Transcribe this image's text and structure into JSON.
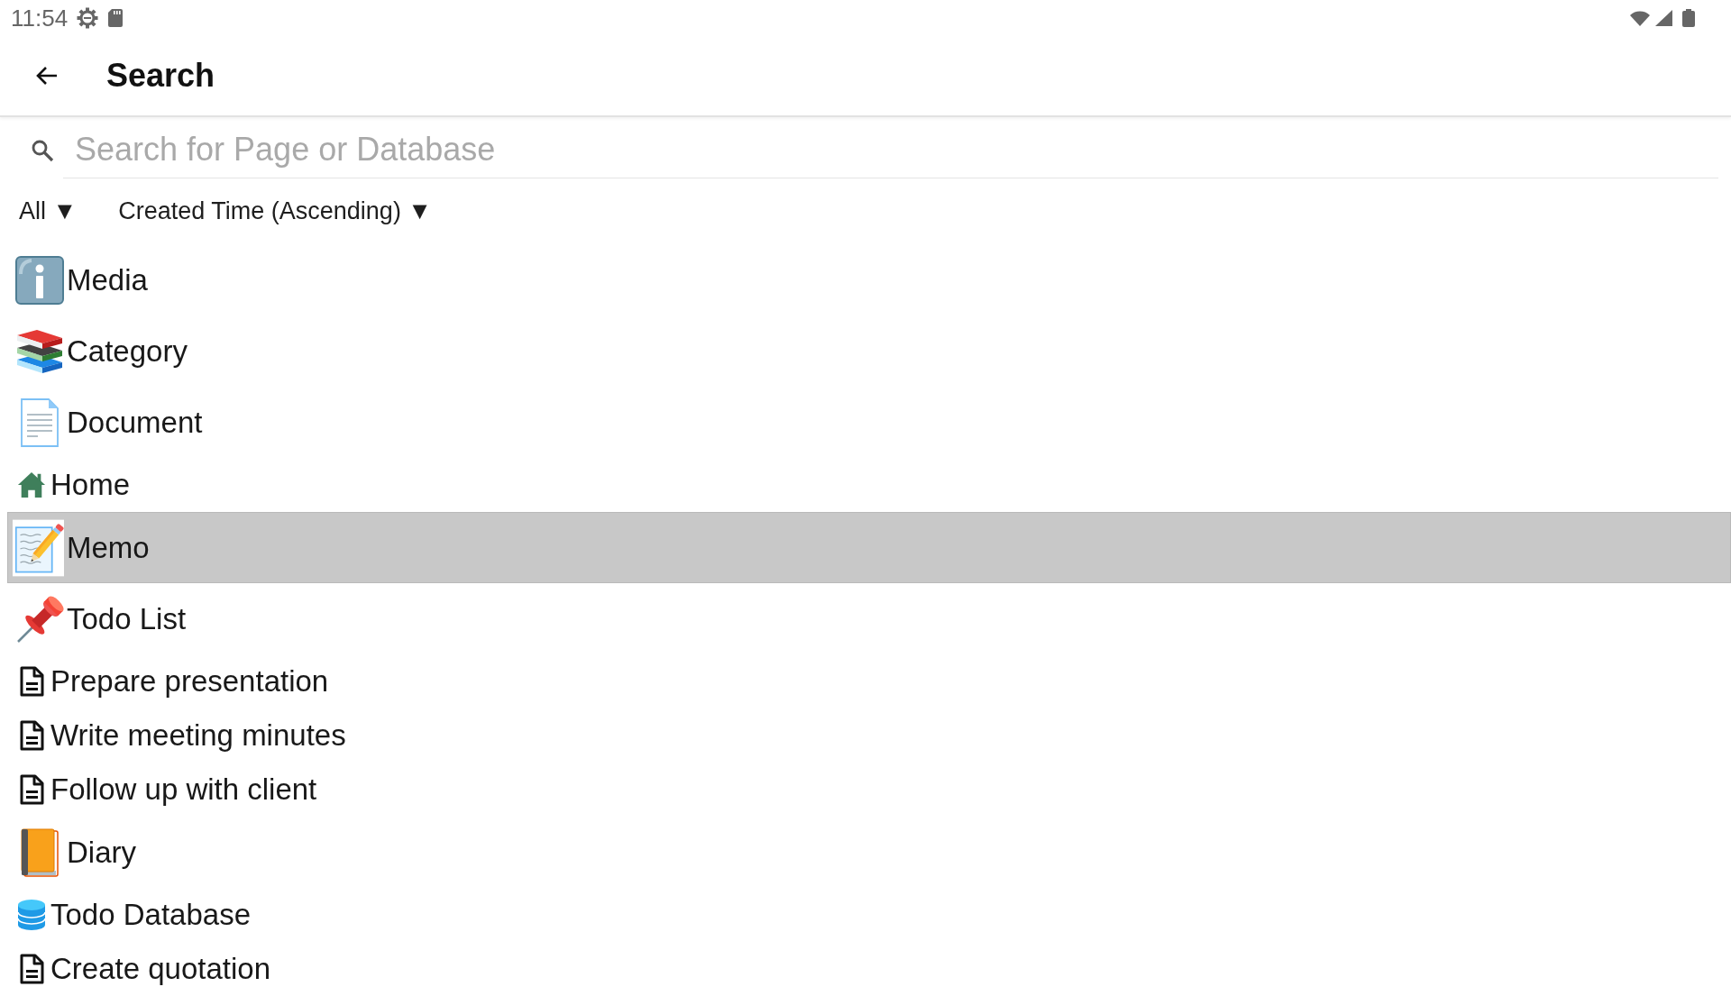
{
  "status_bar": {
    "time": "11:54"
  },
  "app_bar": {
    "title": "Search"
  },
  "search": {
    "placeholder": "Search for Page or Database"
  },
  "filters": {
    "type": "All ▼",
    "sort": "Created Time (Ascending) ▼"
  },
  "items": [
    {
      "title": "Media",
      "kind": "info",
      "selected": false
    },
    {
      "title": "Category",
      "kind": "books",
      "selected": false
    },
    {
      "title": "Document",
      "kind": "page",
      "selected": false
    },
    {
      "title": "Home",
      "kind": "house",
      "selected": false
    },
    {
      "title": "Memo",
      "kind": "memo",
      "selected": true
    },
    {
      "title": "Todo List",
      "kind": "pushpin",
      "selected": false
    },
    {
      "title": "Prepare presentation",
      "kind": "file",
      "selected": false
    },
    {
      "title": "Write meeting minutes",
      "kind": "file",
      "selected": false
    },
    {
      "title": "Follow up with client",
      "kind": "file",
      "selected": false
    },
    {
      "title": "Diary",
      "kind": "book",
      "selected": false
    },
    {
      "title": "Todo Database",
      "kind": "database",
      "selected": false
    },
    {
      "title": "Create quotation",
      "kind": "file",
      "selected": false
    }
  ]
}
